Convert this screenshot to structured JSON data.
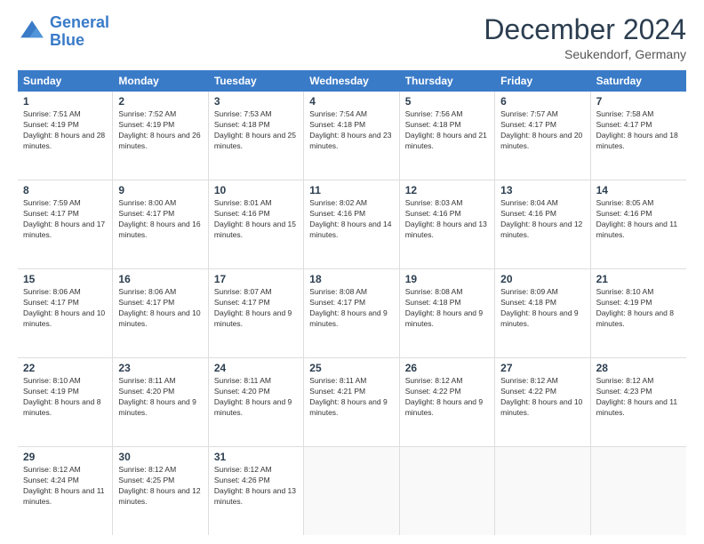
{
  "header": {
    "logo_general": "General",
    "logo_blue": "Blue",
    "title": "December 2024",
    "subtitle": "Seukendorf, Germany"
  },
  "calendar": {
    "days": [
      "Sunday",
      "Monday",
      "Tuesday",
      "Wednesday",
      "Thursday",
      "Friday",
      "Saturday"
    ],
    "rows": [
      [
        {
          "day": "1",
          "sunrise": "7:51 AM",
          "sunset": "4:19 PM",
          "daylight": "8 hours and 28 minutes."
        },
        {
          "day": "2",
          "sunrise": "7:52 AM",
          "sunset": "4:19 PM",
          "daylight": "8 hours and 26 minutes."
        },
        {
          "day": "3",
          "sunrise": "7:53 AM",
          "sunset": "4:18 PM",
          "daylight": "8 hours and 25 minutes."
        },
        {
          "day": "4",
          "sunrise": "7:54 AM",
          "sunset": "4:18 PM",
          "daylight": "8 hours and 23 minutes."
        },
        {
          "day": "5",
          "sunrise": "7:56 AM",
          "sunset": "4:18 PM",
          "daylight": "8 hours and 21 minutes."
        },
        {
          "day": "6",
          "sunrise": "7:57 AM",
          "sunset": "4:17 PM",
          "daylight": "8 hours and 20 minutes."
        },
        {
          "day": "7",
          "sunrise": "7:58 AM",
          "sunset": "4:17 PM",
          "daylight": "8 hours and 18 minutes."
        }
      ],
      [
        {
          "day": "8",
          "sunrise": "7:59 AM",
          "sunset": "4:17 PM",
          "daylight": "8 hours and 17 minutes."
        },
        {
          "day": "9",
          "sunrise": "8:00 AM",
          "sunset": "4:17 PM",
          "daylight": "8 hours and 16 minutes."
        },
        {
          "day": "10",
          "sunrise": "8:01 AM",
          "sunset": "4:16 PM",
          "daylight": "8 hours and 15 minutes."
        },
        {
          "day": "11",
          "sunrise": "8:02 AM",
          "sunset": "4:16 PM",
          "daylight": "8 hours and 14 minutes."
        },
        {
          "day": "12",
          "sunrise": "8:03 AM",
          "sunset": "4:16 PM",
          "daylight": "8 hours and 13 minutes."
        },
        {
          "day": "13",
          "sunrise": "8:04 AM",
          "sunset": "4:16 PM",
          "daylight": "8 hours and 12 minutes."
        },
        {
          "day": "14",
          "sunrise": "8:05 AM",
          "sunset": "4:16 PM",
          "daylight": "8 hours and 11 minutes."
        }
      ],
      [
        {
          "day": "15",
          "sunrise": "8:06 AM",
          "sunset": "4:17 PM",
          "daylight": "8 hours and 10 minutes."
        },
        {
          "day": "16",
          "sunrise": "8:06 AM",
          "sunset": "4:17 PM",
          "daylight": "8 hours and 10 minutes."
        },
        {
          "day": "17",
          "sunrise": "8:07 AM",
          "sunset": "4:17 PM",
          "daylight": "8 hours and 9 minutes."
        },
        {
          "day": "18",
          "sunrise": "8:08 AM",
          "sunset": "4:17 PM",
          "daylight": "8 hours and 9 minutes."
        },
        {
          "day": "19",
          "sunrise": "8:08 AM",
          "sunset": "4:18 PM",
          "daylight": "8 hours and 9 minutes."
        },
        {
          "day": "20",
          "sunrise": "8:09 AM",
          "sunset": "4:18 PM",
          "daylight": "8 hours and 9 minutes."
        },
        {
          "day": "21",
          "sunrise": "8:10 AM",
          "sunset": "4:19 PM",
          "daylight": "8 hours and 8 minutes."
        }
      ],
      [
        {
          "day": "22",
          "sunrise": "8:10 AM",
          "sunset": "4:19 PM",
          "daylight": "8 hours and 8 minutes."
        },
        {
          "day": "23",
          "sunrise": "8:11 AM",
          "sunset": "4:20 PM",
          "daylight": "8 hours and 9 minutes."
        },
        {
          "day": "24",
          "sunrise": "8:11 AM",
          "sunset": "4:20 PM",
          "daylight": "8 hours and 9 minutes."
        },
        {
          "day": "25",
          "sunrise": "8:11 AM",
          "sunset": "4:21 PM",
          "daylight": "8 hours and 9 minutes."
        },
        {
          "day": "26",
          "sunrise": "8:12 AM",
          "sunset": "4:22 PM",
          "daylight": "8 hours and 9 minutes."
        },
        {
          "day": "27",
          "sunrise": "8:12 AM",
          "sunset": "4:22 PM",
          "daylight": "8 hours and 10 minutes."
        },
        {
          "day": "28",
          "sunrise": "8:12 AM",
          "sunset": "4:23 PM",
          "daylight": "8 hours and 11 minutes."
        }
      ],
      [
        {
          "day": "29",
          "sunrise": "8:12 AM",
          "sunset": "4:24 PM",
          "daylight": "8 hours and 11 minutes."
        },
        {
          "day": "30",
          "sunrise": "8:12 AM",
          "sunset": "4:25 PM",
          "daylight": "8 hours and 12 minutes."
        },
        {
          "day": "31",
          "sunrise": "8:12 AM",
          "sunset": "4:26 PM",
          "daylight": "8 hours and 13 minutes."
        },
        null,
        null,
        null,
        null
      ]
    ]
  }
}
